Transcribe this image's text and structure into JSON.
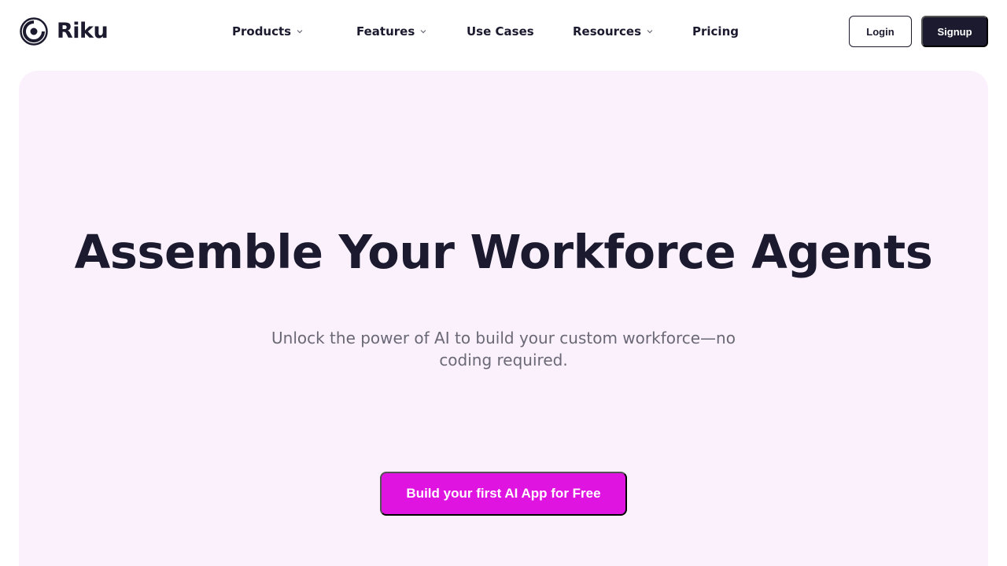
{
  "brand": {
    "name": "Riku"
  },
  "nav": {
    "items": [
      {
        "label": "Products",
        "has_dropdown": true
      },
      {
        "label": "Features",
        "has_dropdown": true
      },
      {
        "label": "Use Cases",
        "has_dropdown": false
      },
      {
        "label": "Resources",
        "has_dropdown": true
      },
      {
        "label": "Pricing",
        "has_dropdown": false
      }
    ],
    "login_label": "Login",
    "signup_label": "Signup"
  },
  "hero": {
    "title": "Assemble Your Workforce Agents",
    "subtitle": "Unlock the power of AI to build your custom workforce—no coding required.",
    "cta_label": "Build your first AI App for Free"
  },
  "colors": {
    "primary_dark": "#1b1a2e",
    "hero_background": "#faf1fd",
    "cta_magenta": "#e014e0",
    "subtitle_gray": "#6b6876"
  },
  "icons": [
    "riku-logo-icon",
    "chevron-down-icon"
  ]
}
